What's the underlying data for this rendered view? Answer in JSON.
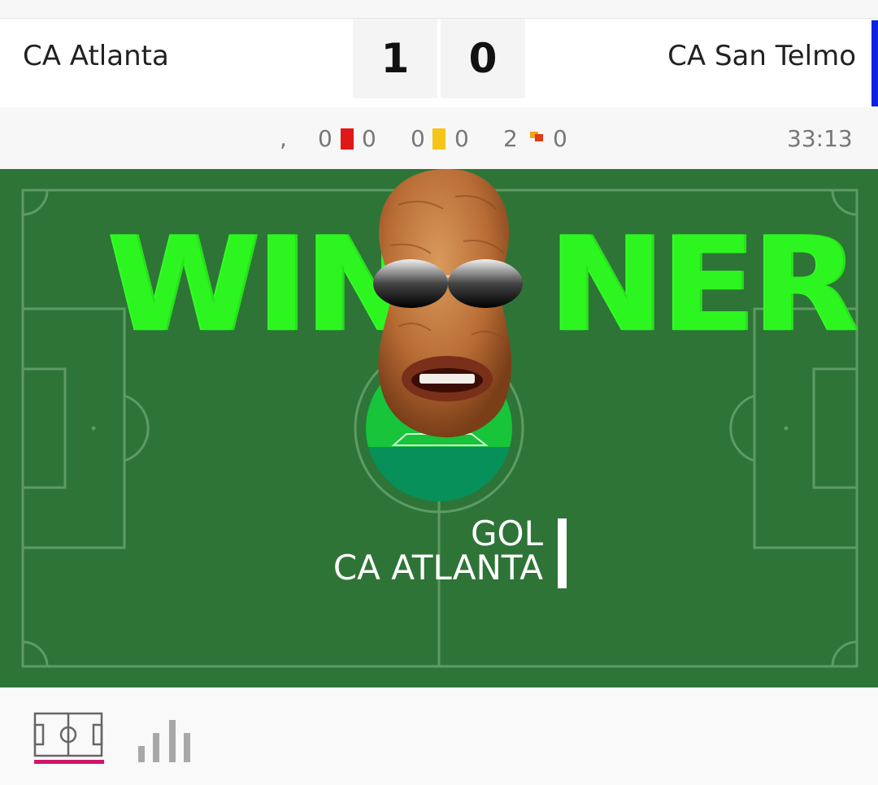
{
  "match": {
    "home_team": "CA Atlanta",
    "away_team": "CA San Telmo",
    "home_score": "1",
    "away_score": "0",
    "away_color": "#1020e0"
  },
  "stats": {
    "separator": ",",
    "red_home": "0",
    "red_away": "0",
    "yellow_home": "0",
    "yellow_away": "0",
    "corner_home": "2",
    "corner_away": "0",
    "clock": "33:13"
  },
  "overlay": {
    "winner_left": "WIN",
    "winner_right": "NER",
    "winner_color": "#2cf51f"
  },
  "event": {
    "line1": "GOL",
    "line2": "CA ATLANTA"
  },
  "tabs": {
    "field_icon": "field-icon",
    "stats_icon": "bar-chart-icon",
    "active_color": "#d0156a"
  }
}
